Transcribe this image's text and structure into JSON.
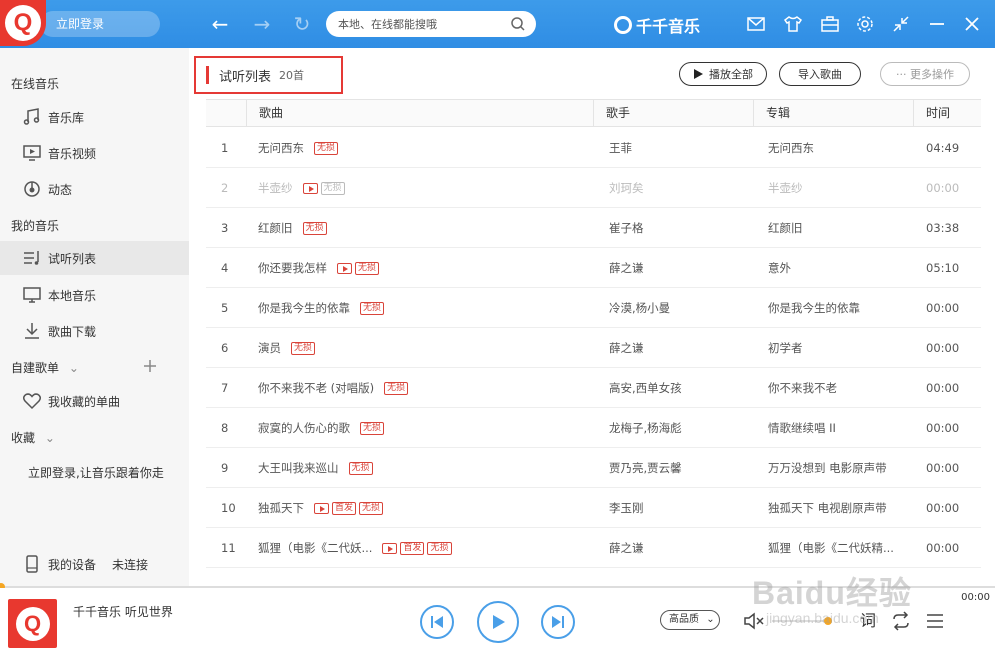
{
  "header": {
    "login_label": "立即登录",
    "search_placeholder": "本地、在线都能搜哦",
    "brand": "千千音乐"
  },
  "sidebar": {
    "online_title": "在线音乐",
    "online_items": [
      {
        "label": "音乐库",
        "icon": "music-note-icon"
      },
      {
        "label": "音乐视频",
        "icon": "monitor-play-icon"
      },
      {
        "label": "动态",
        "icon": "dynamic-icon"
      }
    ],
    "my_title": "我的音乐",
    "my_items": [
      {
        "label": "试听列表",
        "icon": "playlist-icon"
      },
      {
        "label": "本地音乐",
        "icon": "monitor-icon"
      },
      {
        "label": "歌曲下载",
        "icon": "download-icon"
      }
    ],
    "custom_title": "自建歌单",
    "favorite_label": "我收藏的单曲",
    "collect_title": "收藏",
    "login_hint": "立即登录,让音乐跟着你走",
    "device_label": "我的设备",
    "device_status": "未连接"
  },
  "list": {
    "title": "试听列表",
    "count": "20首",
    "play_all": "播放全部",
    "import": "导入歌曲",
    "more": "··· 更多操作",
    "columns": [
      "歌曲",
      "歌手",
      "专辑",
      "时间"
    ],
    "rows": [
      {
        "num": "1",
        "song": "无问西东",
        "mv": false,
        "first": false,
        "lossless": true,
        "artist": "王菲",
        "album": "无问西东",
        "time": "04:49",
        "dim": false
      },
      {
        "num": "2",
        "song": "半壶纱",
        "mv": true,
        "first": false,
        "lossless": true,
        "artist": "刘珂矣",
        "album": "半壶纱",
        "time": "00:00",
        "dim": true
      },
      {
        "num": "3",
        "song": "红颜旧",
        "mv": false,
        "first": false,
        "lossless": true,
        "artist": "崔子格",
        "album": "红颜旧",
        "time": "03:38",
        "dim": false
      },
      {
        "num": "4",
        "song": "你还要我怎样",
        "mv": true,
        "first": false,
        "lossless": true,
        "artist": "薛之谦",
        "album": "意外",
        "time": "05:10",
        "dim": false
      },
      {
        "num": "5",
        "song": "你是我今生的依靠",
        "mv": false,
        "first": false,
        "lossless": true,
        "artist": "冷漠,杨小曼",
        "album": "你是我今生的依靠",
        "time": "00:00",
        "dim": false
      },
      {
        "num": "6",
        "song": "演员",
        "mv": false,
        "first": false,
        "lossless": true,
        "artist": "薛之谦",
        "album": "初学者",
        "time": "00:00",
        "dim": false
      },
      {
        "num": "7",
        "song": "你不来我不老 (对唱版)",
        "mv": false,
        "first": false,
        "lossless": true,
        "artist": "高安,西单女孩",
        "album": "你不来我不老",
        "time": "00:00",
        "dim": false
      },
      {
        "num": "8",
        "song": "寂寞的人伤心的歌",
        "mv": false,
        "first": false,
        "lossless": true,
        "artist": "龙梅子,杨海彪",
        "album": "情歌继续唱 II",
        "time": "00:00",
        "dim": false
      },
      {
        "num": "9",
        "song": "大王叫我来巡山",
        "mv": false,
        "first": false,
        "lossless": true,
        "artist": "贾乃亮,贾云馨",
        "album": "万万没想到 电影原声带",
        "time": "00:00",
        "dim": false
      },
      {
        "num": "10",
        "song": "独孤天下",
        "mv": true,
        "first": true,
        "lossless": true,
        "artist": "李玉刚",
        "album": "独孤天下 电视剧原声带",
        "time": "00:00",
        "dim": false
      },
      {
        "num": "11",
        "song": "狐狸（电影《二代妖...",
        "mv": true,
        "first": true,
        "lossless": true,
        "artist": "薛之谦",
        "album": "狐狸（电影《二代妖精...",
        "time": "00:00",
        "dim": false
      }
    ],
    "tag_lossless": "无损",
    "tag_first": "首发"
  },
  "player": {
    "now_playing": "千千音乐 听见世界",
    "quality": "高品质",
    "time": "00:00",
    "lyrics_label": "词"
  },
  "watermark": {
    "main": "Baidu经验",
    "sub": "jingyan.baidu.com"
  },
  "colors": {
    "header_blue": "#2f8de4",
    "accent_red": "#e53935",
    "tag_red": "#d9443a",
    "player_blue": "#4a9fe8"
  }
}
